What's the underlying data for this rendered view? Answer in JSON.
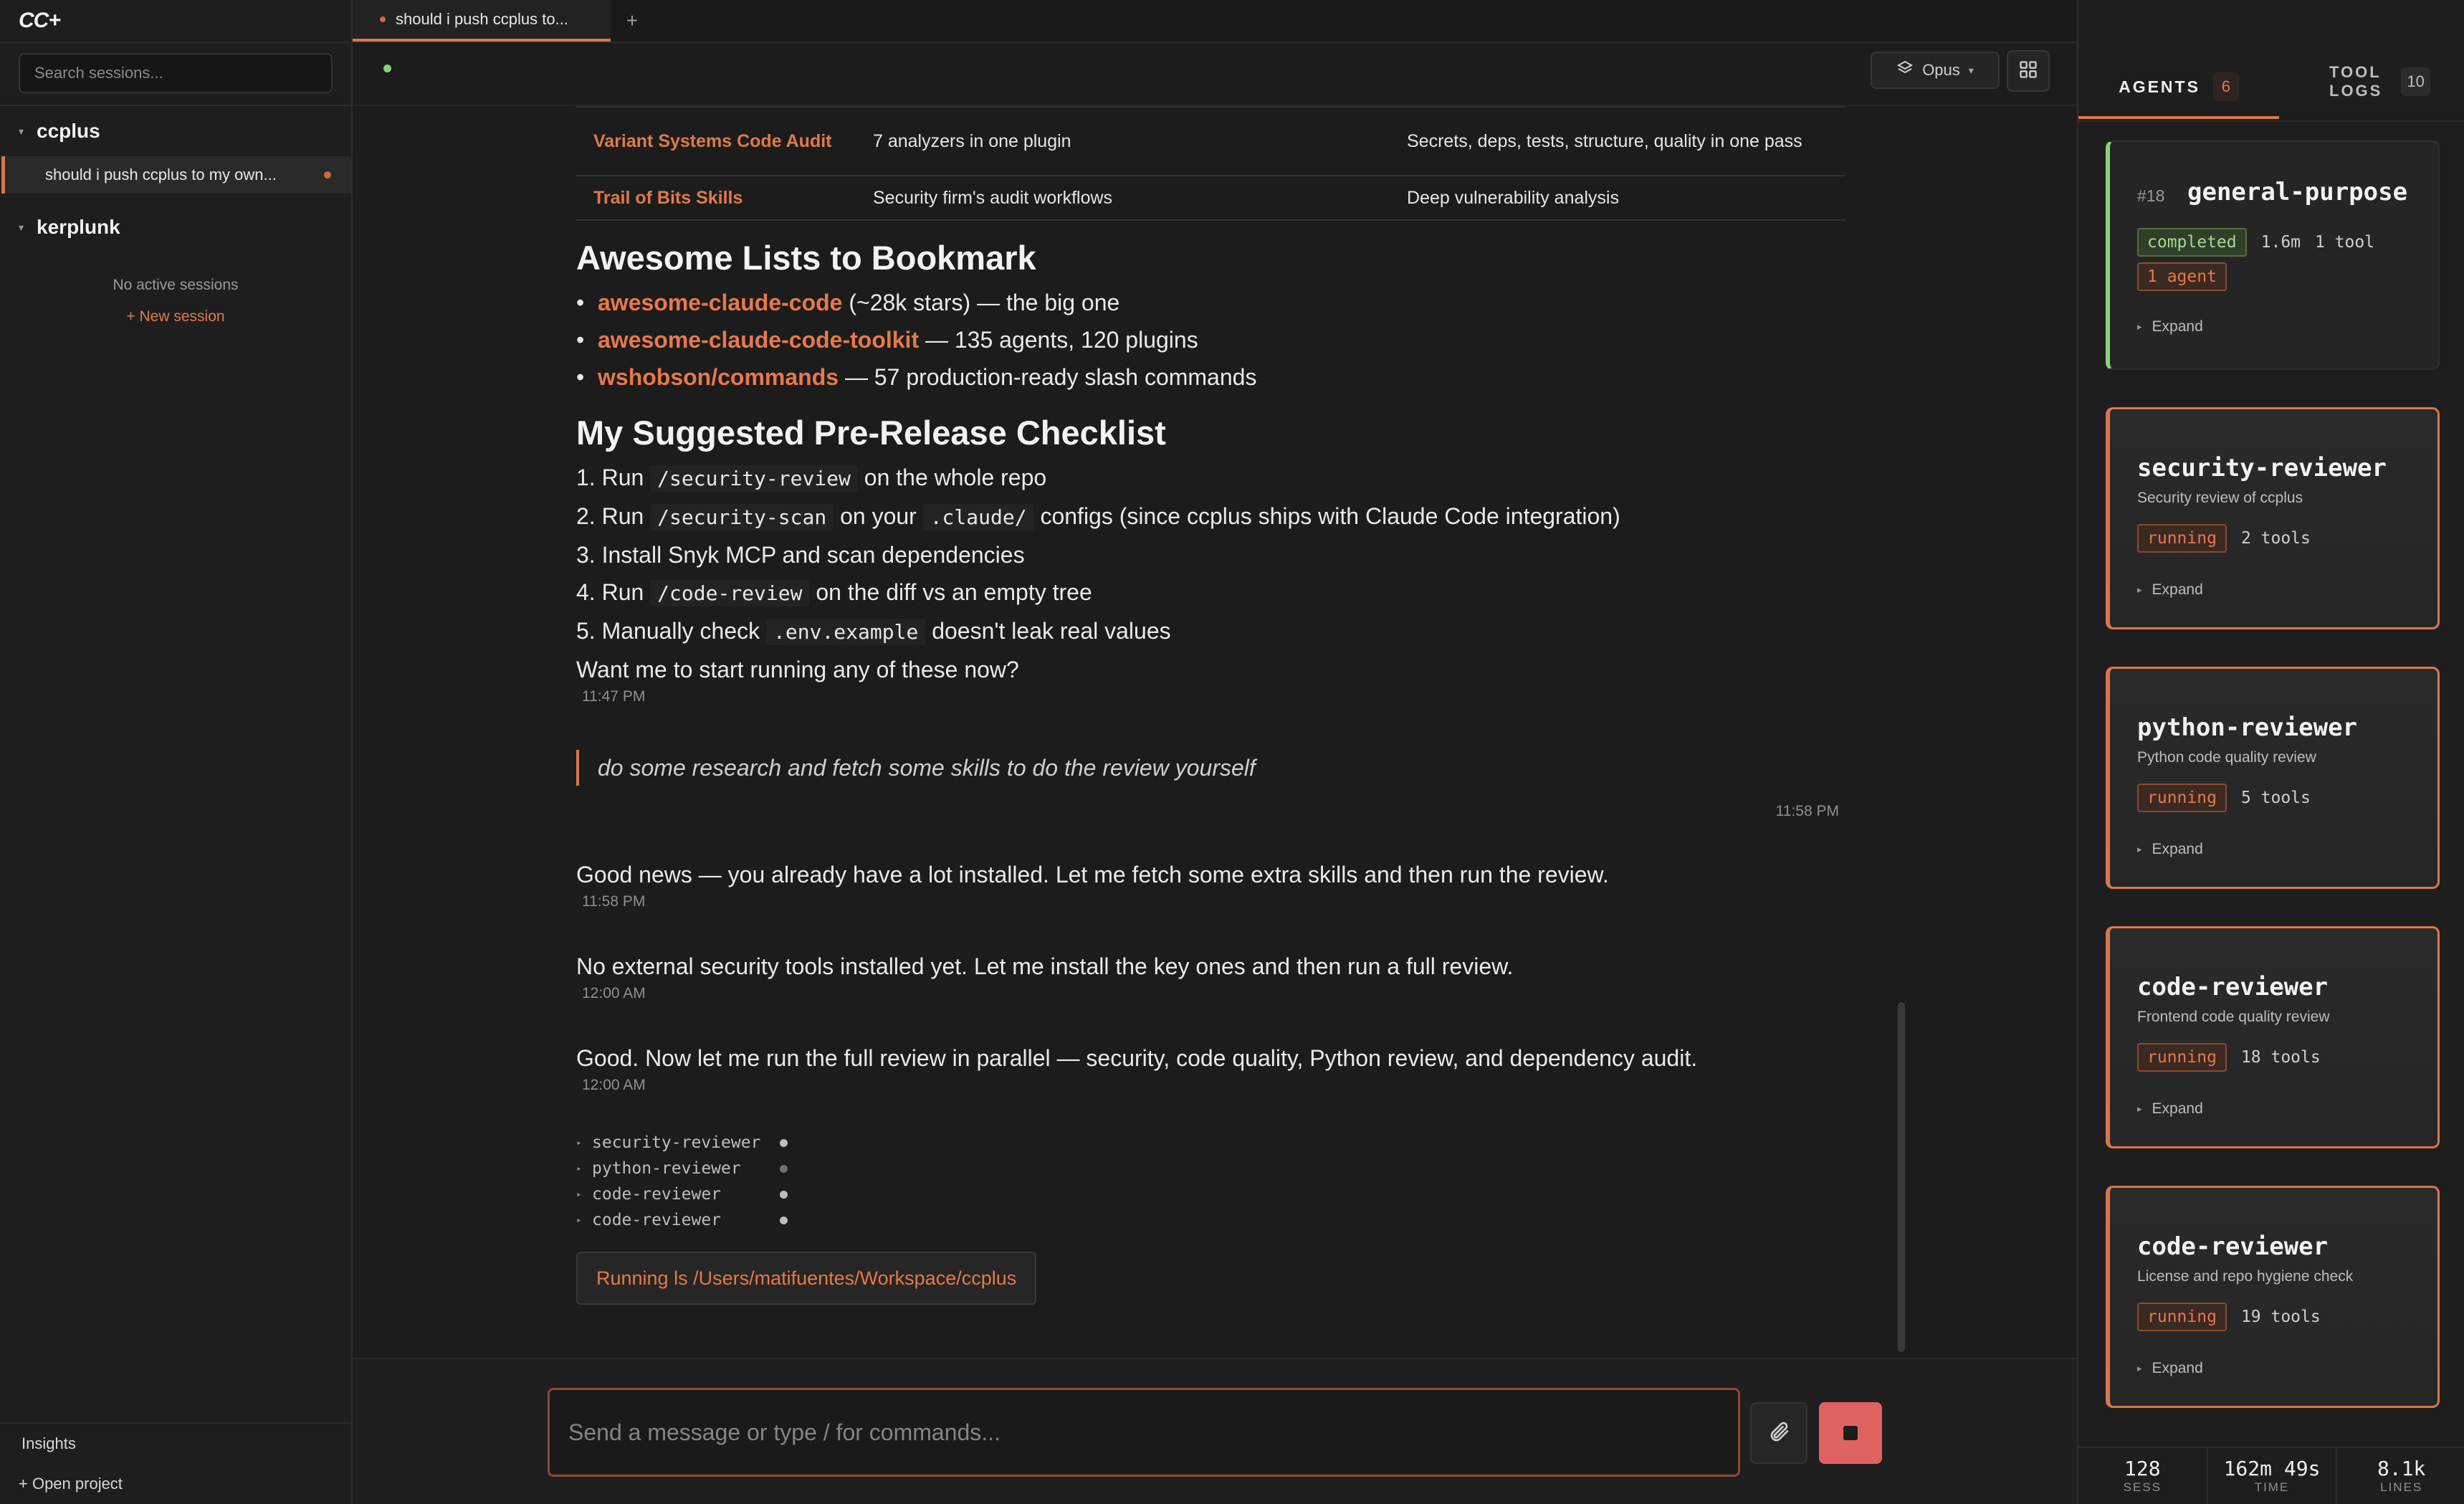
{
  "app": {
    "logo": "CC+"
  },
  "sidebar": {
    "search_placeholder": "Search sessions...",
    "projects": [
      {
        "name": "ccplus",
        "sessions": [
          {
            "title": "should i push ccplus to my own..."
          }
        ]
      },
      {
        "name": "kerplunk",
        "empty_text": "No active sessions",
        "new_session": "+ New session"
      }
    ],
    "insights": "Insights",
    "open_project": "+ Open project"
  },
  "tabs": {
    "active": "should i push ccplus to...",
    "add": "+"
  },
  "toolbar": {
    "model": "Opus"
  },
  "chat": {
    "table": [
      {
        "name": "Variant Systems Code Audit",
        "desc": "7 analyzers in one plugin",
        "notes": "Secrets, deps, tests, structure, quality in one pass"
      },
      {
        "name": "Trail of Bits Skills",
        "desc": "Security firm's audit workflows",
        "notes": "Deep vulnerability analysis"
      }
    ],
    "lists_heading": "Awesome Lists to Bookmark",
    "lists": [
      {
        "link": "awesome-claude-code",
        "rest": " (~28k stars) — the big one"
      },
      {
        "link": "awesome-claude-code-toolkit",
        "rest": " — 135 agents, 120 plugins"
      },
      {
        "link": "wshobson/commands",
        "rest": " — 57 production-ready slash commands"
      }
    ],
    "checklist_heading": "My Suggested Pre-Release Checklist",
    "checklist": [
      {
        "n": "1.",
        "a": "Run",
        "c1": "/security-review",
        "b": "on the whole repo",
        "c2": "",
        "d": ""
      },
      {
        "n": "2.",
        "a": "Run",
        "c1": "/security-scan",
        "b": "on your",
        "c2": ".claude/",
        "d": "configs (since ccplus ships with Claude Code integration)"
      },
      {
        "n": "3.",
        "a": "Install Snyk MCP and scan dependencies",
        "c1": "",
        "b": "",
        "c2": "",
        "d": ""
      },
      {
        "n": "4.",
        "a": "Run",
        "c1": "/code-review",
        "b": "on the diff vs an empty tree",
        "c2": "",
        "d": ""
      },
      {
        "n": "5.",
        "a": "Manually check",
        "c1": ".env.example",
        "b": "doesn't leak real values",
        "c2": "",
        "d": ""
      }
    ],
    "closing": "Want me to start running any of these now?",
    "ts1": "11:47 PM",
    "user_message": "do some research and fetch some skills to do the review yourself",
    "ts_user": "11:58 PM",
    "msg1": "Good news — you already have a lot installed. Let me fetch some extra skills and then run the review.",
    "ts2": "11:58 PM",
    "msg2": "No external security tools installed yet. Let me install the key ones and then run a full review.",
    "ts3": "12:00 AM",
    "msg3": "Good. Now let me run the full review in parallel — security, code quality, Python review, and dependency audit.",
    "ts4": "12:00 AM",
    "agents_inline": [
      "security-reviewer",
      "python-reviewer",
      "code-reviewer",
      "code-reviewer"
    ],
    "running": "Running ls /Users/matifuentes/Workspace/ccplus"
  },
  "input": {
    "placeholder": "Send a message or type / for commands..."
  },
  "rpanel": {
    "agents_label": "AGENTS",
    "agents_count": "6",
    "tools_label_1": "TOOL",
    "tools_label_2": "LOGS",
    "tools_count": "10",
    "cards": [
      {
        "num": "#18",
        "name": "general-purpose",
        "status": "completed",
        "time": "1.6m",
        "tools": "1 tool",
        "agents": "1 agent",
        "expand": "Expand"
      },
      {
        "name": "security-reviewer",
        "sub": "Security review of ccplus",
        "status": "running",
        "tools": "2 tools",
        "expand": "Expand"
      },
      {
        "name": "python-reviewer",
        "sub": "Python code quality review",
        "status": "running",
        "tools": "5 tools",
        "expand": "Expand"
      },
      {
        "name": "code-reviewer",
        "sub": "Frontend code quality review",
        "status": "running",
        "tools": "18 tools",
        "expand": "Expand"
      },
      {
        "name": "code-reviewer",
        "sub": "License and repo hygiene check",
        "status": "running",
        "tools": "19 tools",
        "expand": "Expand"
      }
    ],
    "stats": [
      {
        "value": "128",
        "label": "SESS"
      },
      {
        "value": "162m 49s",
        "label": "TIME"
      },
      {
        "value": "8.1k",
        "label": "LINES"
      }
    ]
  },
  "colors": {
    "accent": "#d9774a",
    "success": "#8bd17c",
    "stop": "#e06363"
  }
}
